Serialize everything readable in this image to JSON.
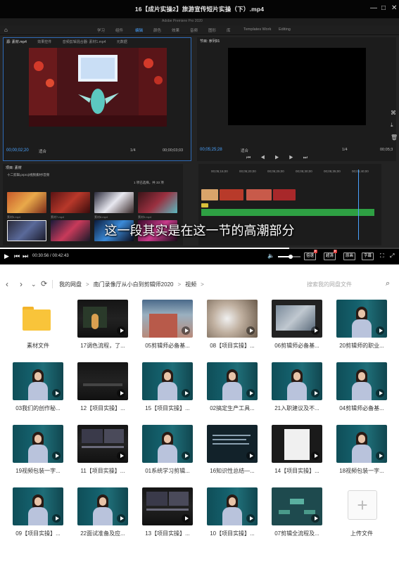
{
  "player": {
    "title": "16【成片实操2】旅游宣传短片实操（下）.mp4",
    "window_controls": [
      "—",
      "□",
      "✕"
    ],
    "premiere": {
      "menubar_hint": "Adobe Premiere Pro 2020",
      "workspaces": [
        "学习",
        "组件",
        "编辑",
        "颜色",
        "效果",
        "音频",
        "图形",
        "库",
        "Templates Work",
        "Editing"
      ],
      "active_workspace": "编辑",
      "source_tabs": [
        "源: 素材.mp4",
        "效果控件",
        "音频剪辑混合器: 素材1.mp4",
        "元数据"
      ],
      "program_tab": "节目: 序列01",
      "source_tc_left": "00;00;02;20",
      "source_tc_right": "00;00;03;03",
      "source_fit": "适合",
      "source_scale": "1/4",
      "program_tc_left": "00;05;25;28",
      "program_tc_right": "00;05;3",
      "program_fit": "适合",
      "program_scale": "1/4",
      "transport_icons": "⏮ ◀ ▶ ▶ ⏭",
      "project_title": "项目: 素材",
      "project_path": "十二剪辑.prproj\\视频素材\\音频",
      "project_count": "1 项已选择，共 33 项",
      "timeline_ruler": [
        "00;05;15;00",
        "00;05;20;00",
        "00;05;25;00",
        "00;05;30;00",
        "00;05;35;00",
        "00;05;40;00"
      ],
      "thumb_labels": [
        "素材5.mp4",
        "素材7.mp4",
        "素材8.mp4",
        "素材9.mp4",
        "素材10.mp4",
        "素材11.mp4",
        "素材12.mp4",
        "素材13.mp4"
      ]
    },
    "subtitle": "这一段其实是在这一节的高潮部分",
    "time_current": "00:30:56",
    "time_total": "00:42:43",
    "time_display": "00:30:56 / 00:42:43",
    "progress": 0.724,
    "volume": 0.55,
    "buttons": [
      {
        "label": "倍速",
        "badge": "新"
      },
      {
        "label": "超清",
        "badge": "新"
      },
      {
        "label": "原画",
        "badge": ""
      },
      {
        "label": "字幕",
        "badge": ""
      }
    ],
    "icons": [
      "play-icon",
      "prev-icon",
      "next-icon",
      "volume-icon",
      "fullscreen-icon",
      "pip-icon"
    ]
  },
  "browser": {
    "breadcrumb": [
      "我的网盘",
      "南门录像厅从小白到剪辑师2020",
      "视频"
    ],
    "search_placeholder": "搜索我的网盘文件",
    "files": [
      {
        "name": "素材文件",
        "type": "folder"
      },
      {
        "name": "17调色流程，了...",
        "type": "video",
        "thumb": "dark-person"
      },
      {
        "name": "05剪辑师必备基...",
        "type": "video",
        "thumb": "building"
      },
      {
        "name": "08【项目实操】...",
        "type": "video",
        "thumb": "blur"
      },
      {
        "name": "06剪辑师必备基...",
        "type": "video",
        "thumb": "screen"
      },
      {
        "name": "20剪辑师的职业...",
        "type": "video",
        "thumb": "teal-person"
      },
      {
        "name": "03我们的创作秘...",
        "type": "video",
        "thumb": "teal-person"
      },
      {
        "name": "12【项目实操】...",
        "type": "video",
        "thumb": "dark"
      },
      {
        "name": "15【项目实操】...",
        "type": "video",
        "thumb": "teal-person"
      },
      {
        "name": "02搞定生产工具...",
        "type": "video",
        "thumb": "teal-person"
      },
      {
        "name": "21入职建议及不...",
        "type": "video",
        "thumb": "teal-person"
      },
      {
        "name": "04剪辑师必备基...",
        "type": "video",
        "thumb": "teal-person"
      },
      {
        "name": "19视频包装一字...",
        "type": "video",
        "thumb": "teal-person"
      },
      {
        "name": "11【项目实操】...",
        "type": "video",
        "thumb": "dark-ui"
      },
      {
        "name": "01系统学习剪辑...",
        "type": "video",
        "thumb": "teal-person"
      },
      {
        "name": "16知识性总结—...",
        "type": "video",
        "thumb": "text-dark"
      },
      {
        "name": "14【项目实操】...",
        "type": "video",
        "thumb": "doc"
      },
      {
        "name": "18视频包装一字...",
        "type": "video",
        "thumb": "teal-person"
      },
      {
        "name": "09【项目实操】...",
        "type": "video",
        "thumb": "teal-person"
      },
      {
        "name": "22面试准备及应...",
        "type": "video",
        "thumb": "teal-person"
      },
      {
        "name": "13【项目实操】...",
        "type": "video",
        "thumb": "dark-ui"
      },
      {
        "name": "10【项目实操】...",
        "type": "video",
        "thumb": "teal-person"
      },
      {
        "name": "07剪辑全流程及...",
        "type": "video",
        "thumb": "diagram"
      },
      {
        "name": "上传文件",
        "type": "upload"
      }
    ]
  },
  "colors": {
    "premiere_blue": "#4aa3ff",
    "folder_yellow": "#f9c43a",
    "badge_red": "#e0312f",
    "audio_green": "#2ea043"
  }
}
